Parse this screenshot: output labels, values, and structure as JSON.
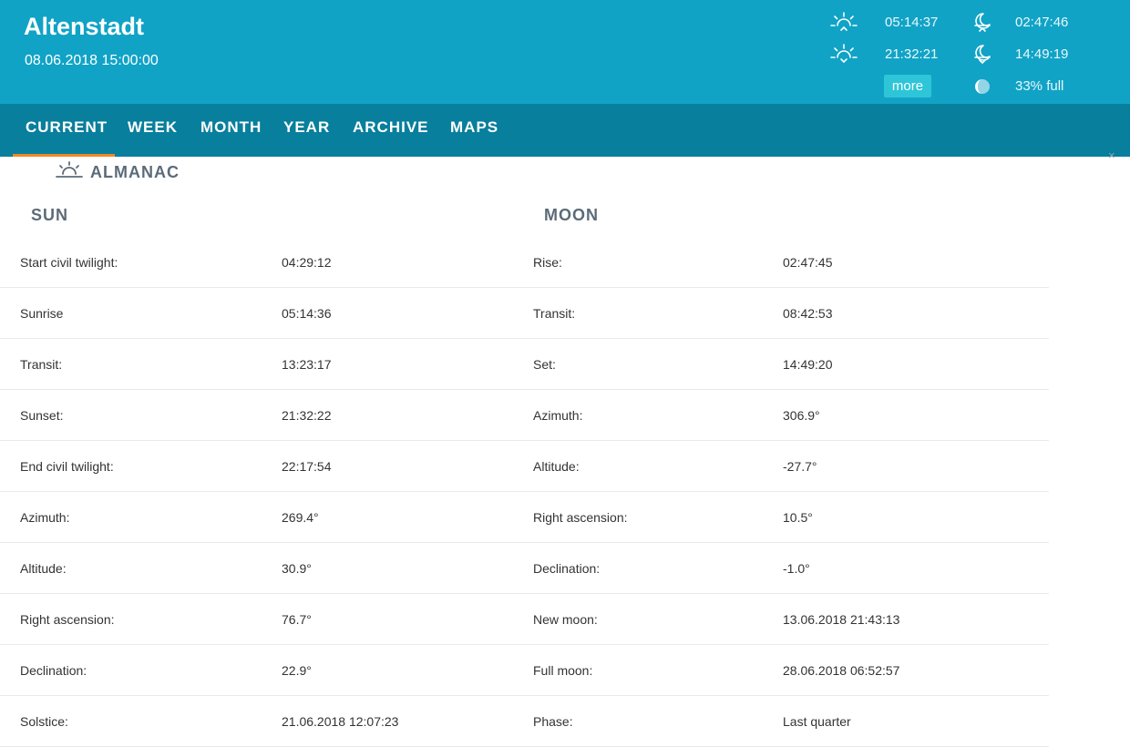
{
  "header": {
    "station_name": "Altenstadt",
    "datetime": "08.06.2018 15:00:00",
    "sunrise_time": "05:14:37",
    "sunset_time": "21:32:21",
    "moonrise_time": "02:47:46",
    "moonset_time": "14:49:19",
    "more_label": "more",
    "moon_phase_text": "33% full",
    "icons": [
      "sunrise-icon",
      "sunset-icon",
      "moonrise-icon",
      "moonset-icon",
      "moon-phase-icon"
    ]
  },
  "nav": {
    "items": [
      {
        "label": "CURRENT"
      },
      {
        "label": "WEEK"
      },
      {
        "label": "MONTH"
      },
      {
        "label": "YEAR"
      },
      {
        "label": "ARCHIVE"
      },
      {
        "label": "MAPS"
      }
    ],
    "active": "CURRENT"
  },
  "almanac": {
    "title": "ALMANAC",
    "sun": {
      "title": "SUN",
      "rows": [
        {
          "label": "Start civil twilight:",
          "value": "04:29:12"
        },
        {
          "label": "Sunrise",
          "value": "05:14:36"
        },
        {
          "label": "Transit:",
          "value": "13:23:17"
        },
        {
          "label": "Sunset:",
          "value": "21:32:22"
        },
        {
          "label": "End civil twilight:",
          "value": "22:17:54"
        },
        {
          "label": "Azimuth:",
          "value": "269.4°"
        },
        {
          "label": "Altitude:",
          "value": "30.9°"
        },
        {
          "label": "Right ascension:",
          "value": "76.7°"
        },
        {
          "label": "Declination:",
          "value": "22.9°"
        },
        {
          "label": "Solstice:",
          "value": "21.06.2018 12:07:23"
        }
      ]
    },
    "moon": {
      "title": "MOON",
      "rows": [
        {
          "label": "Rise:",
          "value": "02:47:45"
        },
        {
          "label": "Transit:",
          "value": "08:42:53"
        },
        {
          "label": "Set:",
          "value": "14:49:20"
        },
        {
          "label": "Azimuth:",
          "value": "306.9°"
        },
        {
          "label": "Altitude:",
          "value": "-27.7°"
        },
        {
          "label": "Right ascension:",
          "value": "10.5°"
        },
        {
          "label": "Declination:",
          "value": "-1.0°"
        },
        {
          "label": "New moon:",
          "value": "13.06.2018 21:43:13"
        },
        {
          "label": "Full moon:",
          "value": "28.06.2018 06:52:57"
        },
        {
          "label": "Phase:",
          "value": "Last quarter"
        }
      ]
    }
  },
  "colors": {
    "header_bg": "#10a3c6",
    "nav_bg": "#087f9d",
    "nav_active_underline": "#f08a24",
    "more_button_bg": "#2ec5d8",
    "section_title": "#5c6b78"
  }
}
